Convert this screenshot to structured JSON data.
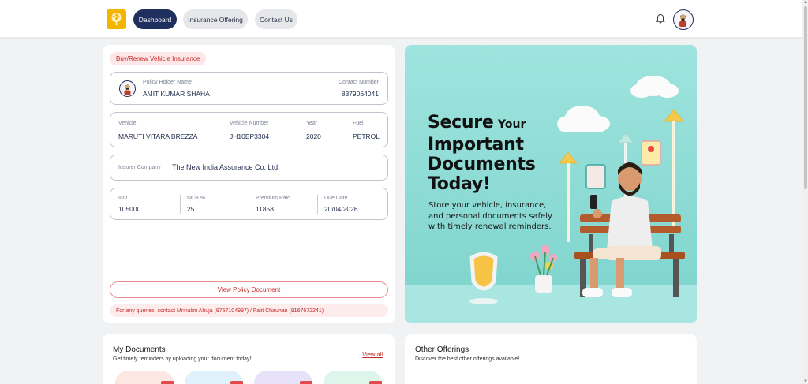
{
  "nav": {
    "items": [
      {
        "label": "Dashboard",
        "active": true
      },
      {
        "label": "Insurance Offering",
        "active": false
      },
      {
        "label": "Contact Us",
        "active": false
      }
    ]
  },
  "policy": {
    "section_pill": "Buy/Renew Vehicle Insurance",
    "holder_label": "Policy Holder Name",
    "holder_value": "AMIT KUMAR SHAHA",
    "contact_label": "Contact Number",
    "contact_value": "8379064041",
    "vehicle_label": "Vehicle",
    "vehicle_value": "MARUTI VITARA BREZZA",
    "vehicle_number_label": "Vehicle Number",
    "vehicle_number_value": "JH10BP3304",
    "year_label": "Year",
    "year_value": "2020",
    "fuel_label": "Fuel",
    "fuel_value": "PETROL",
    "insurer_label": "Insurer Company",
    "insurer_value": "The New India Assurance Co. Ltd.",
    "idv_label": "IDV",
    "idv_value": "105000",
    "ncb_label": "NCB %",
    "ncb_value": "25",
    "premium_label": "Premium Paid",
    "premium_value": "11858",
    "due_label": "Due Date",
    "due_value": "20/04/2026",
    "view_button": "View Policy Document",
    "query_note": "For any queries, contact Mrinalini Ahuja (9757104997) / Falit Chauhan (9167672241)"
  },
  "banner": {
    "headline_1a": "Secure",
    "headline_1b": "Your",
    "headline_2": "Important",
    "headline_3": "Documents",
    "headline_4": "Today!",
    "subtext": "Store your vehicle, insurance, and personal documents safely with timely renewal reminders."
  },
  "documents": {
    "title": "My Documents",
    "subtitle": "Get timely reminders by uploading your document today!",
    "view_all": "View all"
  },
  "offerings": {
    "title": "Other Offerings",
    "subtitle": "Discover the best other offerings available!"
  },
  "colors": {
    "primary": "#1f2f5e",
    "accent_red": "#c62828",
    "banner_bg": "#8fded8"
  },
  "icons": [
    "logo-tree-icon",
    "bell-icon",
    "user-avatar-icon",
    "chevron-up-icon",
    "chevron-down-icon"
  ]
}
